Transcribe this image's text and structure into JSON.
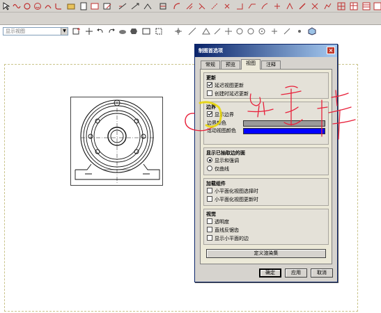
{
  "toolbar": {
    "combo_value": "显示视图"
  },
  "dialog": {
    "title": "制图首选项",
    "tabs": [
      "常规",
      "预览",
      "视图",
      "注释"
    ],
    "active_tab": "视图",
    "update": {
      "title": "更新",
      "delay_view_update": "延迟视图更新",
      "delay_create": "创建时延迟更新"
    },
    "boundary": {
      "title": "边界",
      "show_boundary": "显示边界",
      "boundary_color": "边界颜色",
      "active_view_color": "活动视图颜色",
      "boundary_color_hex": "#9a9a9a",
      "active_view_color_hex": "#0000ff"
    },
    "extracted": {
      "title": "显示已抽取边的面",
      "opt1": "显示和强调",
      "opt2": "仅曲线"
    },
    "loaded": {
      "title": "加载组件",
      "opt1": "小平面化视图选择时",
      "opt2": "小平面化视图更新时"
    },
    "visual": {
      "title": "视觉",
      "opt1": "透明度",
      "opt2": "直线反锯齿",
      "opt3": "显示小平面的边"
    },
    "define_render": "定义渲染集",
    "ok": "确定",
    "apply": "应用",
    "cancel": "取消"
  },
  "annotation": {
    "handwriting": "勾去掉",
    "color": "#e8203a"
  }
}
